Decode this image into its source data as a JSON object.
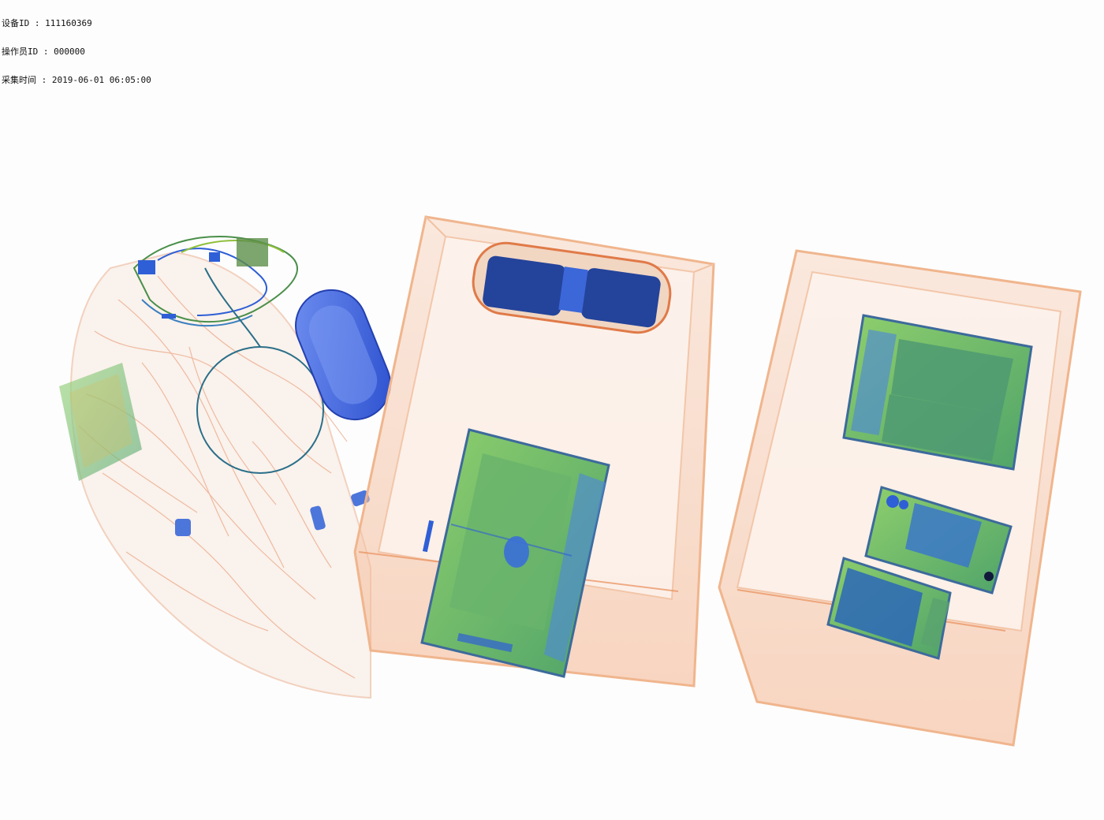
{
  "header": {
    "device_id": "设备ID : 111160369",
    "operator_id": "操作员ID : 000000",
    "capture_time": "采集时间 : 2019-06-01 06:05:00"
  },
  "colors": {
    "organic": "#e8895a",
    "mixed": "#7cc36a",
    "inorganic": "#2f5fd6",
    "background": "#fdfdfd"
  },
  "objects": [
    "soft-bag",
    "cable-bundle",
    "power-bank",
    "plastic-tray-1",
    "speaker",
    "tablet-1",
    "plastic-tray-2",
    "tablet-2",
    "phone",
    "battery-pack"
  ]
}
